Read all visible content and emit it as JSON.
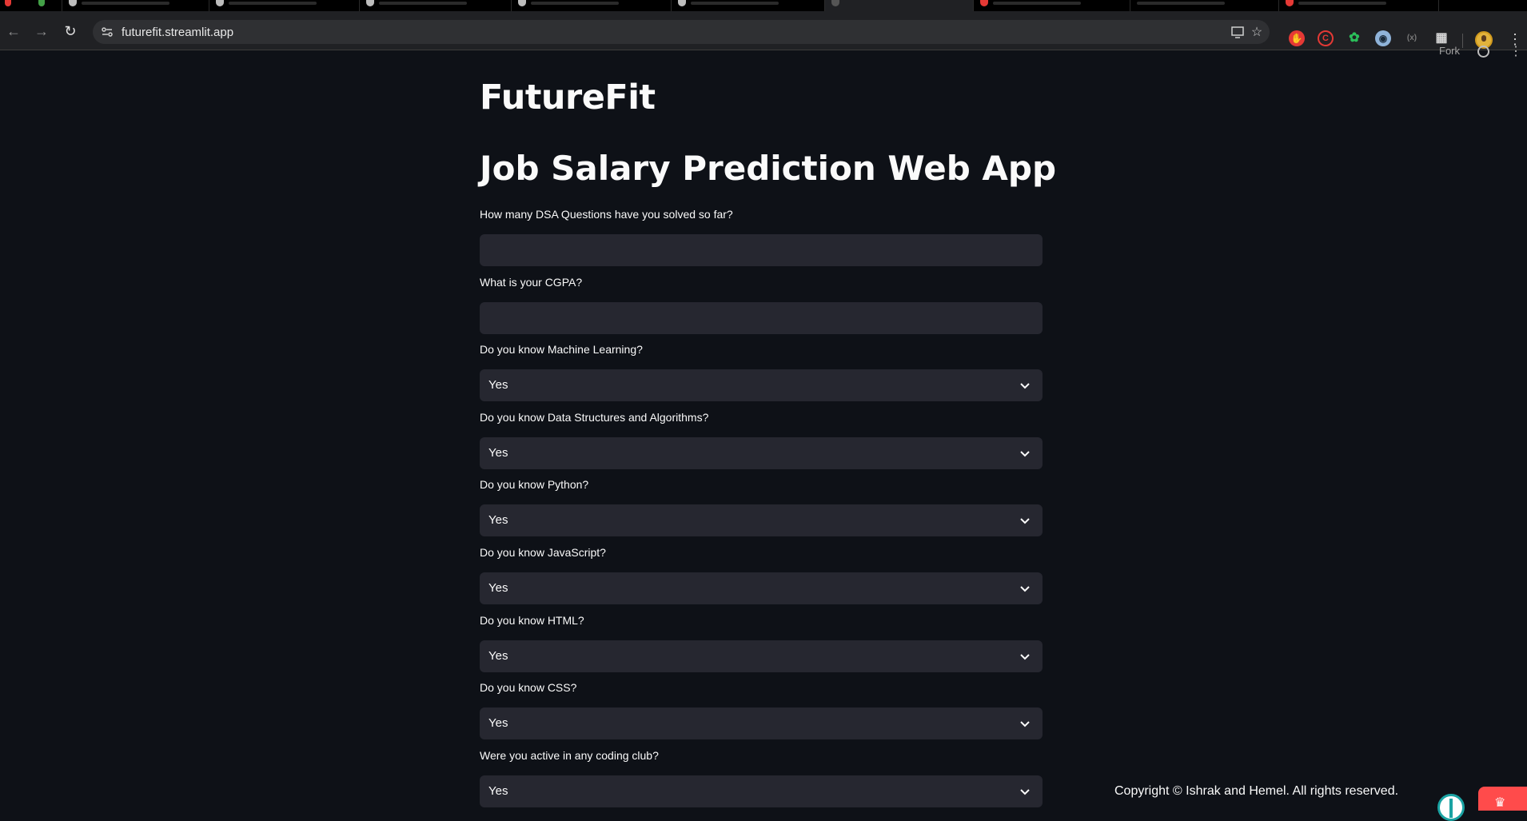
{
  "browser": {
    "url": "futurefit.streamlit.app",
    "tabs": [
      {
        "favicon": "github-icon",
        "active": false
      },
      {
        "favicon": "github-icon",
        "active": false
      },
      {
        "favicon": "github-icon",
        "active": false
      },
      {
        "favicon": "github-icon",
        "active": false
      },
      {
        "favicon": "github-icon",
        "active": false
      },
      {
        "favicon": "streamlit-icon",
        "active": true
      },
      {
        "favicon": "youtube-icon",
        "active": false
      },
      {
        "favicon": "youtube-icon",
        "active": false
      }
    ]
  },
  "header": {
    "fork_label": "Fork"
  },
  "app": {
    "title": "FutureFit",
    "heading": "Job Salary Prediction Web App",
    "fields": [
      {
        "label": "How many DSA Questions have you solved so far?",
        "type": "text",
        "value": ""
      },
      {
        "label": "What is your CGPA?",
        "type": "text",
        "value": ""
      },
      {
        "label": "Do you know Machine Learning?",
        "type": "select",
        "value": "Yes"
      },
      {
        "label": "Do you know Data Structures and Algorithms?",
        "type": "select",
        "value": "Yes"
      },
      {
        "label": "Do you know Python?",
        "type": "select",
        "value": "Yes"
      },
      {
        "label": "Do you know JavaScript?",
        "type": "select",
        "value": "Yes"
      },
      {
        "label": "Do you know HTML?",
        "type": "select",
        "value": "Yes"
      },
      {
        "label": "Do you know CSS?",
        "type": "select",
        "value": "Yes"
      },
      {
        "label": "Were you active in any coding club?",
        "type": "select",
        "value": "Yes"
      }
    ],
    "footer": "Copyright © Ishrak and Hemel. All rights reserved."
  },
  "colors": {
    "background": "#0e1117",
    "input_background": "#262730",
    "text": "#fafafa",
    "streamlit_red": "#ff4b4b"
  }
}
